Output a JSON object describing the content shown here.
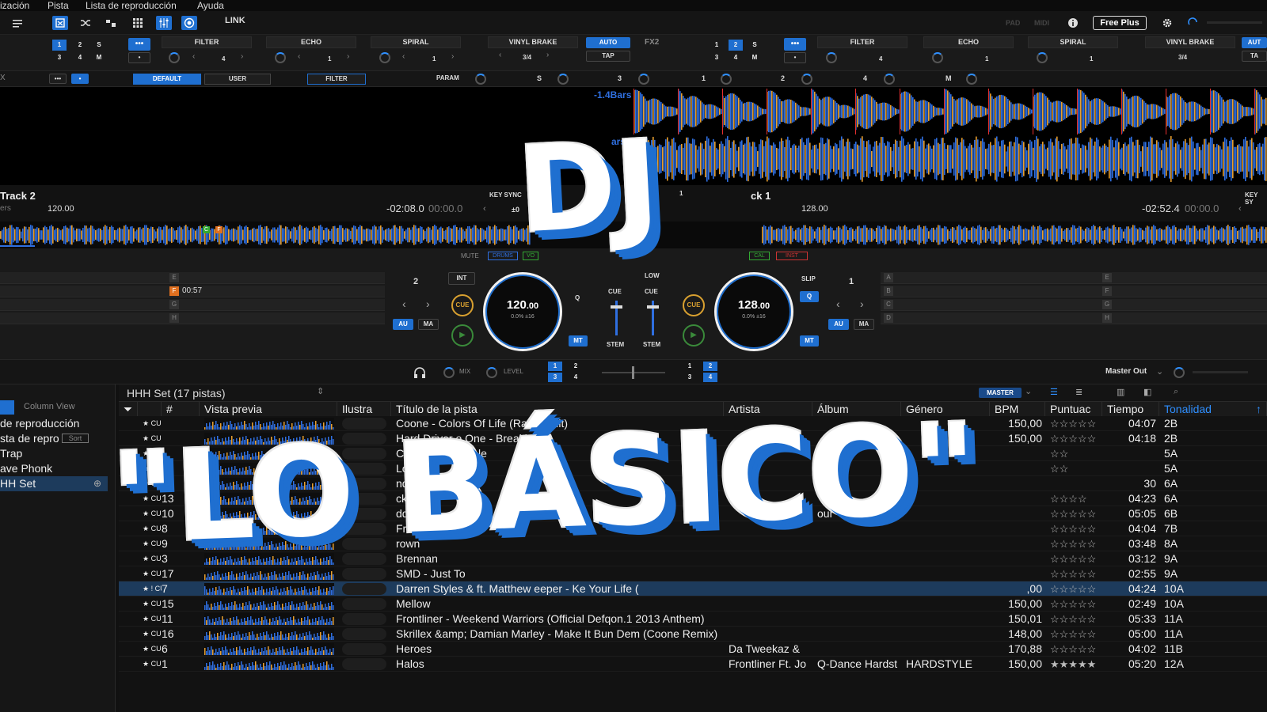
{
  "menu": {
    "items": [
      "ización",
      "Pista",
      "Lista de reproducción",
      "Ayuda"
    ]
  },
  "toolbar": {
    "link": "LINK",
    "pad": "PAD",
    "midi": "MIDI",
    "plan": "Free Plus"
  },
  "fx": {
    "left": {
      "slots": [
        "FILTER",
        "ECHO",
        "SPIRAL"
      ],
      "slot_vals": [
        "4",
        "1",
        "1"
      ],
      "vinyl": "VINYL BRAKE",
      "beat": "3/4",
      "auto": "AUTO",
      "tap": "TAP",
      "nums": [
        "1",
        "2",
        "S",
        "3",
        "4",
        "M"
      ]
    },
    "right": {
      "label": "FX2",
      "slots": [
        "FILTER",
        "ECHO",
        "SPIRAL"
      ],
      "slot_vals": [
        "4",
        "1",
        "1"
      ],
      "vinyl": "VINYL BRAKE",
      "beat": "3/4",
      "auto": "AUT",
      "tap": "TA",
      "nums": [
        "1",
        "2",
        "S",
        "3",
        "4",
        "M"
      ]
    }
  },
  "sampler": {
    "default": "DEFAULT",
    "user": "USER",
    "filter": "FILTER",
    "param": "PARAM",
    "labels": [
      "S",
      "3",
      "1",
      "2",
      "4",
      "M"
    ],
    "x": "X"
  },
  "wave": {
    "bars1": "-1.4Bars",
    "bars2": "ars"
  },
  "deck2": {
    "title": "Track 2",
    "artist": "ers",
    "bpm": "120.00",
    "remain": "-02:08.0",
    "elapsed": "00:00.0",
    "keysync": "KEY SYNC",
    "key_offset": "±0",
    "number": "2",
    "hotcue_f": "F",
    "hotcue_time": "00:57",
    "hot_labels": [
      "E",
      "F",
      "G",
      "H"
    ],
    "tempo": "120",
    "tempo_dec": ".00",
    "pitch": "0.0%",
    "range": "±16",
    "int": "INT",
    "au": "AU",
    "ma": "MA",
    "mt": "MT",
    "q": "Q",
    "cue": "CUE"
  },
  "deck1": {
    "title": "ck 1",
    "bpm": "128.00",
    "remain": "-02:52.4",
    "elapsed": "00:00.0",
    "keysync": "KEY SY",
    "number": "1",
    "hot_labels_a": [
      "A",
      "B",
      "C",
      "D"
    ],
    "hot_labels_b": [
      "E",
      "F",
      "G",
      "H"
    ],
    "tempo": "128",
    "tempo_dec": ".00",
    "pitch": "0.0%",
    "range": "±16",
    "slip": "SLIP",
    "au": "AU",
    "ma": "MA",
    "mt": "MT",
    "q": "Q",
    "cue": "CUE"
  },
  "mixer": {
    "mute": "MUTE",
    "drums": "DRUMS",
    "vo": "VO",
    "cal": "CAL",
    "inst": "INST",
    "low": "LOW",
    "cue": "CUE",
    "stem": "STEM",
    "mix": "MIX",
    "level": "LEVEL",
    "master_out": "Master Out",
    "deck_nums": [
      "1",
      "2",
      "3",
      "4"
    ]
  },
  "sidebar": {
    "column_view": "Column View",
    "items": [
      "de reproducción",
      "sta de repro",
      "Trap",
      "ave Phonk",
      "HH Set"
    ],
    "sort": "Sort"
  },
  "browser": {
    "playlist_title": "HHH Set (17 pistas)",
    "master": "MASTER",
    "columns": [
      "#",
      "Vista previa",
      "Ilustra",
      "Título de la pista",
      "Artista",
      "Álbum",
      "Género",
      "BPM",
      "Puntuac",
      "Tiempo",
      "Tonalidad"
    ],
    "rows": [
      {
        "cue": "★ CUE",
        "num": "",
        "title": "Coone - Colors Of Life (Radio Edit)",
        "artist": "",
        "album": "",
        "genre": "",
        "bpm": "150,00",
        "stars": "☆☆☆☆☆",
        "time": "04:07",
        "key": "2B"
      },
      {
        "cue": "★ CUE",
        "num": "",
        "title": "Hard Driver      e One - Breakin  R",
        "artist": "",
        "album": "",
        "genre": "",
        "bpm": "150,00",
        "stars": "☆☆☆☆☆",
        "time": "04:18",
        "key": "2B"
      },
      {
        "cue": "★ CUE",
        "num": "",
        "title": "Coone -        (Available",
        "artist": "",
        "album": "",
        "genre": "",
        "bpm": "",
        "stars": "☆☆",
        "time": "",
        "key": "5A"
      },
      {
        "cue": "★ CUE",
        "num": "",
        "title": "Lost In F",
        "artist": "",
        "album": "",
        "genre": "",
        "bpm": "",
        "stars": "☆☆",
        "time": "",
        "key": "5A"
      },
      {
        "cue": "★ CUE",
        "num": "2",
        "title": "ndrew",
        "artist": "",
        "album": "",
        "genre": "",
        "bpm": "",
        "stars": "",
        "time": "30",
        "key": "6A"
      },
      {
        "cue": "★ CUE",
        "num": "13",
        "title": "     ckin",
        "artist": "",
        "album": "",
        "genre": "",
        "bpm": "",
        "stars": "☆☆☆☆",
        "time": "04:23",
        "key": "6A"
      },
      {
        "cue": "★ CUE",
        "num": "10",
        "title": "     dde",
        "artist": "",
        "album": "our",
        "genre": "",
        "bpm": "",
        "stars": "☆☆☆☆☆",
        "time": "05:05",
        "key": "6B"
      },
      {
        "cue": "★ CUE",
        "num": "8",
        "title": "     Fr",
        "artist": "",
        "album": "",
        "genre": "",
        "bpm": "",
        "stars": "☆☆☆☆☆",
        "time": "04:04",
        "key": "7B"
      },
      {
        "cue": "★ CUE",
        "num": "9",
        "title": "rown",
        "artist": "",
        "album": "",
        "genre": "",
        "bpm": "",
        "stars": "☆☆☆☆☆",
        "time": "03:48",
        "key": "8A"
      },
      {
        "cue": "★ CUE",
        "num": "3",
        "title": "Brennan",
        "artist": "",
        "album": "",
        "genre": "",
        "bpm": "",
        "stars": "☆☆☆☆☆",
        "time": "03:12",
        "key": "9A"
      },
      {
        "cue": "★ CUE",
        "num": "17",
        "title": "SMD - Just              To",
        "artist": "",
        "album": "",
        "genre": "",
        "bpm": "",
        "stars": "☆☆☆☆☆",
        "time": "02:55",
        "key": "9A"
      },
      {
        "cue": "★ ! CUE",
        "num": "7",
        "title": "Darren Styles &       ft. Matthew     eeper - Ke      Your Life (",
        "artist": "",
        "album": "",
        "genre": "",
        "bpm": "   ,00",
        "stars": "☆☆☆☆☆",
        "time": "04:24",
        "key": "10A",
        "selected": true
      },
      {
        "cue": "★ CUE",
        "num": "15",
        "title": "Mellow",
        "artist": "",
        "album": "",
        "genre": "",
        "bpm": "150,00",
        "stars": "☆☆☆☆☆",
        "time": "02:49",
        "key": "10A"
      },
      {
        "cue": "★ CUE",
        "num": "11",
        "title": "Frontliner - Weekend Warriors (Official Defqon.1 2013 Anthem)",
        "artist": "",
        "album": "",
        "genre": "",
        "bpm": "150,01",
        "stars": "☆☆☆☆☆",
        "time": "05:33",
        "key": "11A"
      },
      {
        "cue": "★ CUE",
        "num": "16",
        "title": "Skrillex &amp; Damian Marley - Make It Bun Dem (Coone Remix)",
        "artist": "",
        "album": "",
        "genre": "",
        "bpm": "148,00",
        "stars": "☆☆☆☆☆",
        "time": "05:00",
        "key": "11A"
      },
      {
        "cue": "★ CUE",
        "num": "6",
        "title": "Heroes",
        "artist": "Da Tweekaz &",
        "album": "",
        "genre": "",
        "bpm": "170,88",
        "stars": "☆☆☆☆☆",
        "time": "04:02",
        "key": "11B"
      },
      {
        "cue": "★ CUE",
        "num": "1",
        "title": "Halos",
        "artist": "Frontliner Ft. Jo",
        "album": "Q-Dance Hardst",
        "genre": "HARDSTYLE",
        "bpm": "150,00",
        "stars": "★★★★★",
        "time": "05:20",
        "key": "12A"
      }
    ]
  },
  "overlay": {
    "line1": "DJ",
    "line2": "\"LO BÁSICO\""
  },
  "colors": {
    "accent": "#1f6fd0",
    "cue": "#d8a030",
    "wave_orange": "#e8a030",
    "wave_blue": "#2f6fe0"
  }
}
